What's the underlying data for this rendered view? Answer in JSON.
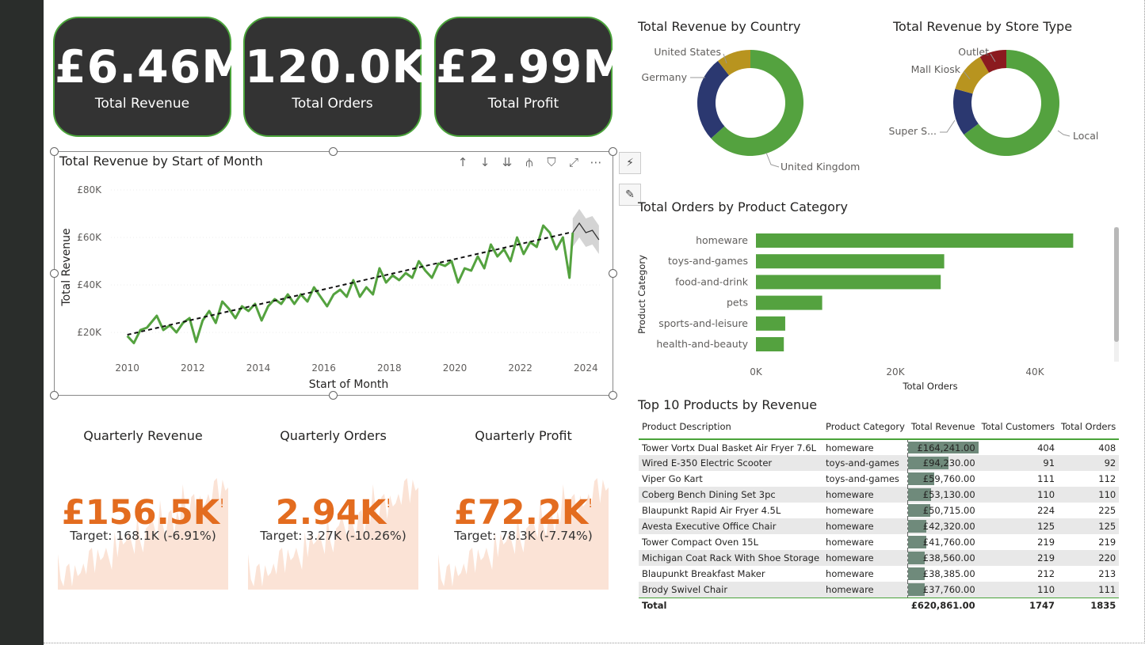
{
  "kpis": [
    {
      "value": "£6.46M",
      "label": "Total Revenue"
    },
    {
      "value": "120.0K",
      "label": "Total Orders"
    },
    {
      "value": "£2.99M",
      "label": "Total Profit"
    }
  ],
  "line_chart": {
    "title": "Total Revenue by Start of Month",
    "icons": [
      "arrow-up-icon",
      "arrow-down-icon",
      "double-arrow-down-icon",
      "expand-hierarchy-icon",
      "filter-icon",
      "focus-mode-icon",
      "more-options-icon"
    ],
    "icon_glyphs": [
      "↑",
      "↓",
      "⇊",
      "⫛",
      "⛉",
      "⤢",
      "⋯"
    ]
  },
  "side_buttons": [
    {
      "name": "analytics-icon",
      "glyph": "⚡"
    },
    {
      "name": "format-brush-icon",
      "glyph": "✎"
    }
  ],
  "quarterly": [
    {
      "title": "Quarterly Revenue",
      "value": "£156.5K",
      "warn": "!",
      "target": "Target: 168.1K (-6.91%)"
    },
    {
      "title": "Quarterly Orders",
      "value": "2.94K",
      "warn": "!",
      "target": "Target: 3.27K (-10.26%)"
    },
    {
      "title": "Quarterly Profit",
      "value": "£72.2K",
      "warn": "!",
      "target": "Target: 78.3K (-7.74%)"
    }
  ],
  "colors": {
    "green": "#54a23f",
    "navy": "#2b3870",
    "gold": "#b8941f",
    "maroon": "#8b1a1f",
    "orange": "#e36c1f",
    "dark": "#333333"
  },
  "chart_data": [
    {
      "type": "line",
      "title": "Total Revenue by Start of Month",
      "xlabel": "Start of Month",
      "ylabel": "Total Revenue",
      "x_ticks": [
        "2010",
        "2012",
        "2014",
        "2016",
        "2018",
        "2020",
        "2022",
        "2024"
      ],
      "y_ticks": [
        "£20K",
        "£40K",
        "£60K",
        "£80K"
      ],
      "ylim": [
        10000,
        85000
      ],
      "xlim": [
        2009.5,
        2024.5
      ],
      "trend": {
        "start": [
          2010,
          19000
        ],
        "end": [
          2023.5,
          62000
        ]
      },
      "series": [
        {
          "values": [
            [
              2010.0,
              18500
            ],
            [
              2010.2,
              15500
            ],
            [
              2010.4,
              21000
            ],
            [
              2010.6,
              22000
            ],
            [
              2010.9,
              27000
            ],
            [
              2011.1,
              21000
            ],
            [
              2011.3,
              23000
            ],
            [
              2011.5,
              20000
            ],
            [
              2011.7,
              24000
            ],
            [
              2011.9,
              26000
            ],
            [
              2012.1,
              16000
            ],
            [
              2012.3,
              25000
            ],
            [
              2012.5,
              29000
            ],
            [
              2012.7,
              24000
            ],
            [
              2012.9,
              33000
            ],
            [
              2013.1,
              30000
            ],
            [
              2013.3,
              26000
            ],
            [
              2013.5,
              31000
            ],
            [
              2013.7,
              29000
            ],
            [
              2013.9,
              32000
            ],
            [
              2014.1,
              25000
            ],
            [
              2014.3,
              31000
            ],
            [
              2014.5,
              34000
            ],
            [
              2014.7,
              32000
            ],
            [
              2014.9,
              36000
            ],
            [
              2015.1,
              32000
            ],
            [
              2015.3,
              36000
            ],
            [
              2015.5,
              33000
            ],
            [
              2015.7,
              39000
            ],
            [
              2015.9,
              35000
            ],
            [
              2016.1,
              31000
            ],
            [
              2016.3,
              36000
            ],
            [
              2016.5,
              38000
            ],
            [
              2016.7,
              35000
            ],
            [
              2016.9,
              42000
            ],
            [
              2017.1,
              35000
            ],
            [
              2017.3,
              39000
            ],
            [
              2017.5,
              36000
            ],
            [
              2017.7,
              47000
            ],
            [
              2017.9,
              41000
            ],
            [
              2018.1,
              44000
            ],
            [
              2018.3,
              42000
            ],
            [
              2018.5,
              45000
            ],
            [
              2018.7,
              43000
            ],
            [
              2018.9,
              50000
            ],
            [
              2019.1,
              46000
            ],
            [
              2019.3,
              43000
            ],
            [
              2019.5,
              49000
            ],
            [
              2019.7,
              48000
            ],
            [
              2019.9,
              50000
            ],
            [
              2020.1,
              41000
            ],
            [
              2020.3,
              47000
            ],
            [
              2020.5,
              46000
            ],
            [
              2020.7,
              52000
            ],
            [
              2020.9,
              47000
            ],
            [
              2021.1,
              57000
            ],
            [
              2021.3,
              52000
            ],
            [
              2021.5,
              55000
            ],
            [
              2021.7,
              50000
            ],
            [
              2021.9,
              60000
            ],
            [
              2022.1,
              53000
            ],
            [
              2022.3,
              58000
            ],
            [
              2022.5,
              56000
            ],
            [
              2022.7,
              65000
            ],
            [
              2022.9,
              62000
            ],
            [
              2023.1,
              55000
            ],
            [
              2023.3,
              60000
            ],
            [
              2023.5,
              43000
            ],
            [
              2023.6,
              62000
            ]
          ]
        },
        {
          "name": "Forecast",
          "values": [
            [
              2023.6,
              62000
            ],
            [
              2023.8,
              66000
            ],
            [
              2024.0,
              62000
            ],
            [
              2024.2,
              63000
            ],
            [
              2024.4,
              59000
            ]
          ]
        }
      ]
    },
    {
      "type": "pie",
      "title": "Total Revenue by Country",
      "labels": [
        "United Kingdom",
        "Germany",
        "United States"
      ],
      "values": [
        0.633,
        0.262,
        0.105
      ],
      "colors": [
        "#54a23f",
        "#2b3870",
        "#b8941f"
      ]
    },
    {
      "type": "pie",
      "title": "Total Revenue by Store Type",
      "labels": [
        "Local",
        "Super S...",
        "Mall Kiosk",
        "Outlet"
      ],
      "values": [
        0.625,
        0.14,
        0.12,
        0.08
      ],
      "colors": [
        "#54a23f",
        "#2b3870",
        "#b8941f",
        "#8b1a1f"
      ]
    },
    {
      "type": "bar",
      "title": "Total Orders by Product Category",
      "xlabel": "Total Orders",
      "ylabel": "Product Category",
      "categories": [
        "homeware",
        "toys-and-games",
        "food-and-drink",
        "pets",
        "sports-and-leisure",
        "health-and-beauty"
      ],
      "values": [
        45500,
        27000,
        26500,
        9500,
        4200,
        4000
      ],
      "x_ticks": [
        "0K",
        "20K",
        "40K"
      ],
      "xlim": [
        0,
        50000
      ]
    },
    {
      "type": "table",
      "title": "Top 10 Products by Revenue",
      "columns": [
        "Product Description",
        "Product Category",
        "Total Revenue",
        "Total Customers",
        "Total Orders"
      ],
      "rows": [
        [
          "Tower Vortx Dual Basket Air Fryer 7.6L",
          "homeware",
          "£164,241.00",
          "404",
          "408"
        ],
        [
          "Wired E-350 Electric Scooter",
          "toys-and-games",
          "£94,230.00",
          "91",
          "92"
        ],
        [
          "Viper Go Kart",
          "toys-and-games",
          "£59,760.00",
          "111",
          "112"
        ],
        [
          "Coberg Bench Dining Set 3pc",
          "homeware",
          "£53,130.00",
          "110",
          "110"
        ],
        [
          "Blaupunkt Rapid Air Fryer 4.5L",
          "homeware",
          "£50,715.00",
          "224",
          "225"
        ],
        [
          "Avesta Executive Office Chair",
          "homeware",
          "£42,320.00",
          "125",
          "125"
        ],
        [
          "Tower Compact Oven 15L",
          "homeware",
          "£41,760.00",
          "219",
          "219"
        ],
        [
          "Michigan Coat Rack With Shoe Storage",
          "homeware",
          "£38,560.00",
          "219",
          "220"
        ],
        [
          "Blaupunkt Breakfast Maker",
          "homeware",
          "£38,385.00",
          "212",
          "213"
        ],
        [
          "Brody Swivel Chair",
          "homeware",
          "£37,760.00",
          "110",
          "111"
        ]
      ],
      "revenue_values": [
        164241,
        94230,
        59760,
        53130,
        50715,
        42320,
        41760,
        38560,
        38385,
        37760
      ],
      "total": [
        "Total",
        "",
        "£620,861.00",
        "1747",
        "1835"
      ]
    }
  ]
}
